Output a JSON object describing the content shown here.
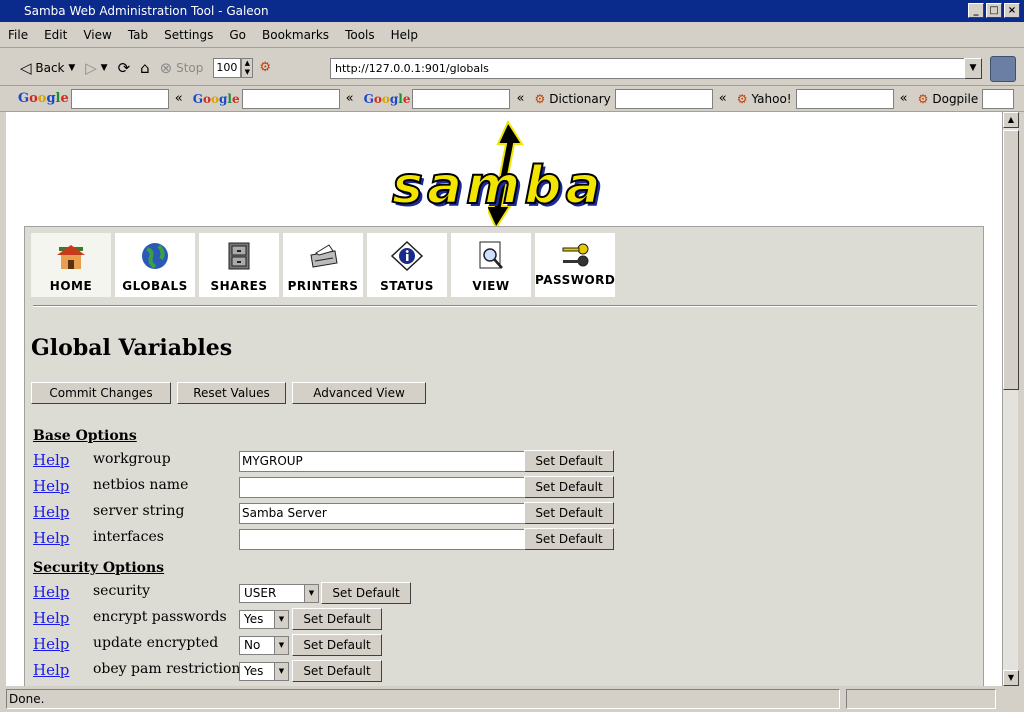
{
  "window": {
    "title": "Samba Web Administration Tool - Galeon",
    "min_glyph": "_",
    "max_glyph": "□",
    "close_glyph": "×"
  },
  "menu": [
    "File",
    "Edit",
    "View",
    "Tab",
    "Settings",
    "Go",
    "Bookmarks",
    "Tools",
    "Help"
  ],
  "nav": {
    "back_label": "Back",
    "stop_label": "Stop",
    "zoom_value": "100",
    "url": "http://127.0.0.1:901/globals"
  },
  "search": {
    "dictionary_label": "Dictionary",
    "yahoo_label": "Yahoo!",
    "dogpile_label": "Dogpile"
  },
  "logo_text": "samba",
  "tabs": [
    {
      "label": "HOME"
    },
    {
      "label": "GLOBALS"
    },
    {
      "label": "SHARES"
    },
    {
      "label": "PRINTERS"
    },
    {
      "label": "STATUS"
    },
    {
      "label": "VIEW"
    },
    {
      "label": "PASSWORD"
    }
  ],
  "page": {
    "title": "Global Variables",
    "buttons": {
      "commit": "Commit Changes",
      "reset": "Reset Values",
      "advanced": "Advanced View"
    }
  },
  "base_options": {
    "title": "Base Options",
    "rows": [
      {
        "help": "Help",
        "label": "workgroup",
        "value": "MYGROUP",
        "button": "Set Default"
      },
      {
        "help": "Help",
        "label": "netbios name",
        "value": "",
        "button": "Set Default"
      },
      {
        "help": "Help",
        "label": "server string",
        "value": "Samba Server",
        "button": "Set Default"
      },
      {
        "help": "Help",
        "label": "interfaces",
        "value": "",
        "button": "Set Default"
      }
    ]
  },
  "security_options": {
    "title": "Security Options",
    "rows": [
      {
        "help": "Help",
        "label": "security",
        "value": "USER",
        "button": "Set Default"
      },
      {
        "help": "Help",
        "label": "encrypt passwords",
        "value": "Yes",
        "button": "Set Default"
      },
      {
        "help": "Help",
        "label": "update encrypted",
        "value": "No",
        "button": "Set Default"
      },
      {
        "help": "Help",
        "label": "obey pam restrictions",
        "value": "Yes",
        "button": "Set Default"
      }
    ]
  },
  "status": {
    "text": "Done."
  }
}
